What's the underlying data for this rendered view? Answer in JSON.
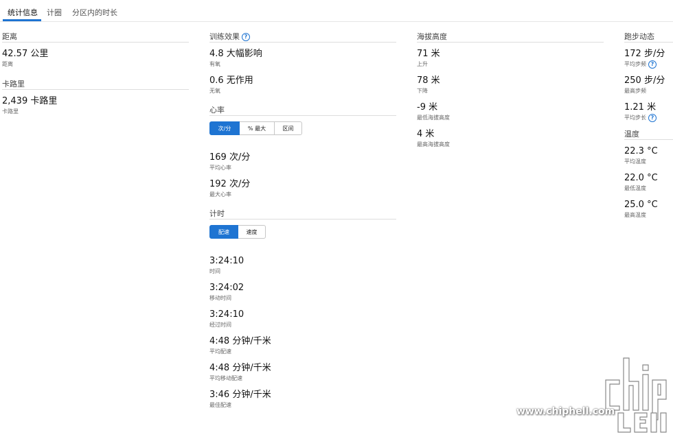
{
  "tabs": [
    "统计信息",
    "计圈",
    "分区内的时长"
  ],
  "distance": {
    "title": "距离",
    "value": "42.57 公里",
    "label": "距离"
  },
  "calories": {
    "title": "卡路里",
    "value": "2,439 卡路里",
    "label": "卡路里"
  },
  "training": {
    "title": "训练效果",
    "aerobic": {
      "value": "4.8 大幅影响",
      "label": "有氧"
    },
    "anaerobic": {
      "value": "0.6 无作用",
      "label": "无氧"
    }
  },
  "heart": {
    "title": "心率",
    "segments": [
      "次/分",
      "% 最大",
      "区间"
    ],
    "avg": {
      "value": "169 次/分",
      "label": "平均心率"
    },
    "max": {
      "value": "192 次/分",
      "label": "最大心率"
    }
  },
  "timing": {
    "title": "计时",
    "segments": [
      "配速",
      "速度"
    ],
    "items": [
      {
        "value": "3:24:10",
        "label": "时间"
      },
      {
        "value": "3:24:02",
        "label": "移动时间"
      },
      {
        "value": "3:24:10",
        "label": "经过时间"
      },
      {
        "value": "4:48 分钟/千米",
        "label": "平均配速"
      },
      {
        "value": "4:48 分钟/千米",
        "label": "平均移动配速"
      },
      {
        "value": "3:46 分钟/千米",
        "label": "最佳配速"
      }
    ]
  },
  "elevation": {
    "title": "海拔高度",
    "items": [
      {
        "value": "71 米",
        "label": "上升"
      },
      {
        "value": "78 米",
        "label": "下降"
      },
      {
        "value": "-9 米",
        "label": "最低海拔高度"
      },
      {
        "value": "4 米",
        "label": "最高海拔高度"
      }
    ]
  },
  "dynamics": {
    "title": "跑步动态",
    "items": [
      {
        "value": "172 步/分",
        "label": "平均步频"
      },
      {
        "value": "250 步/分",
        "label": "最高步频"
      },
      {
        "value": "1.21 米",
        "label": "平均步长"
      }
    ]
  },
  "temperature": {
    "title": "温度",
    "items": [
      {
        "value": "22.3 °C",
        "label": "平均温度"
      },
      {
        "value": "22.0 °C",
        "label": "最低温度"
      },
      {
        "value": "25.0 °C",
        "label": "最高温度"
      }
    ]
  },
  "watermark": {
    "url": "www.chiphell.com"
  },
  "colors": {
    "accent": "#1e74d2"
  }
}
